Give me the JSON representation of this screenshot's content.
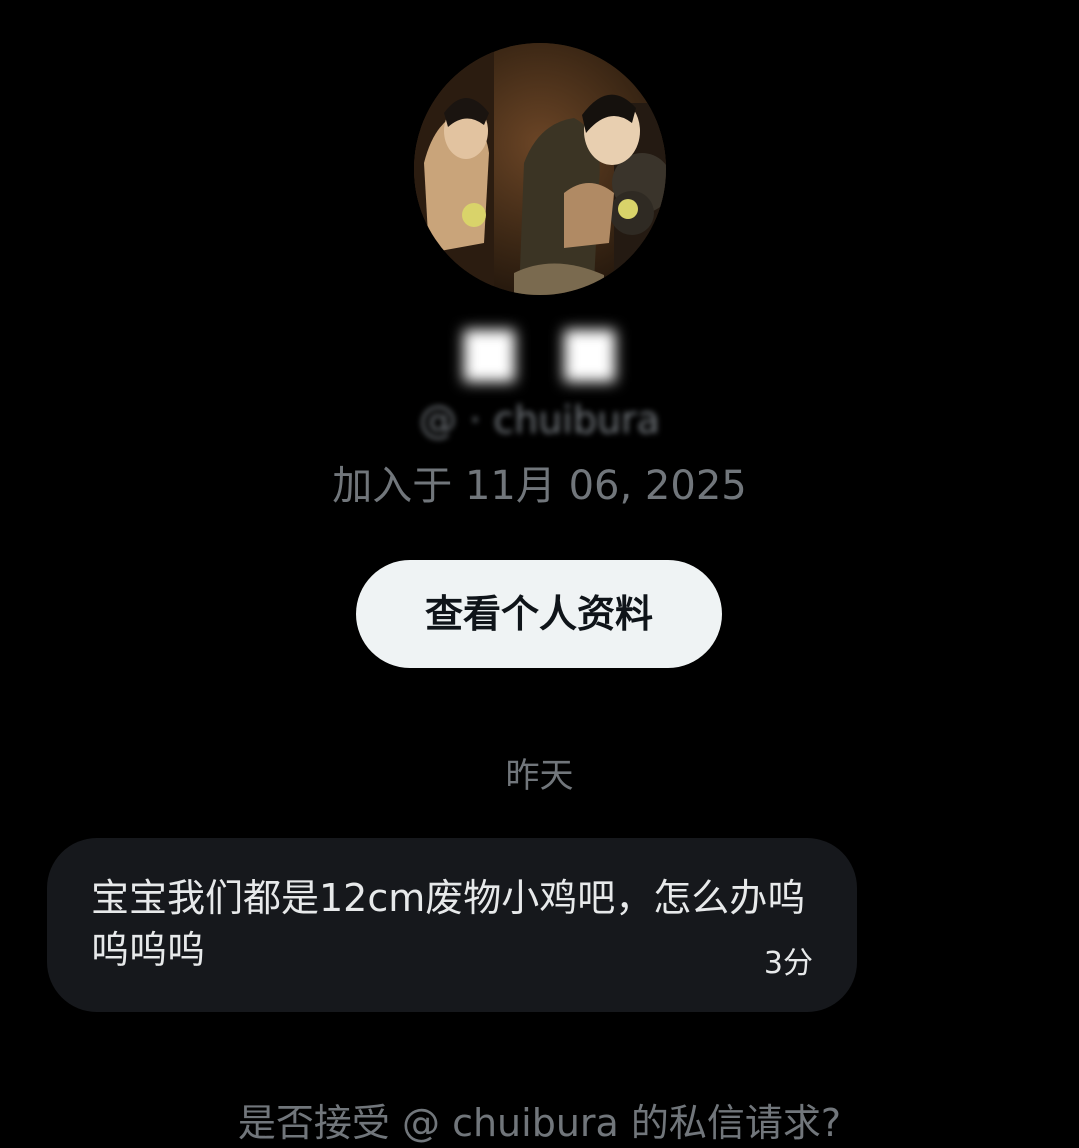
{
  "profile": {
    "avatar_icon": "profile-avatar-image",
    "display_name": "█▌ ▐█",
    "handle": "@ ·  chuibura",
    "joined": "加入于 11月 06, 2025",
    "view_profile_label": "查看个人资料"
  },
  "conversation": {
    "day_divider": "昨天",
    "messages": [
      {
        "text": "宝宝我们都是12cm废物小鸡吧，怎么办呜呜呜呜",
        "time": "3分"
      }
    ],
    "request_prompt": "是否接受 @ chuibura 的私信请求?"
  },
  "colors": {
    "background": "#000000",
    "secondary_text": "#71767b",
    "primary_text": "#e7e9ea",
    "button_bg": "#eff3f4",
    "bubble_bg": "#16181c"
  }
}
